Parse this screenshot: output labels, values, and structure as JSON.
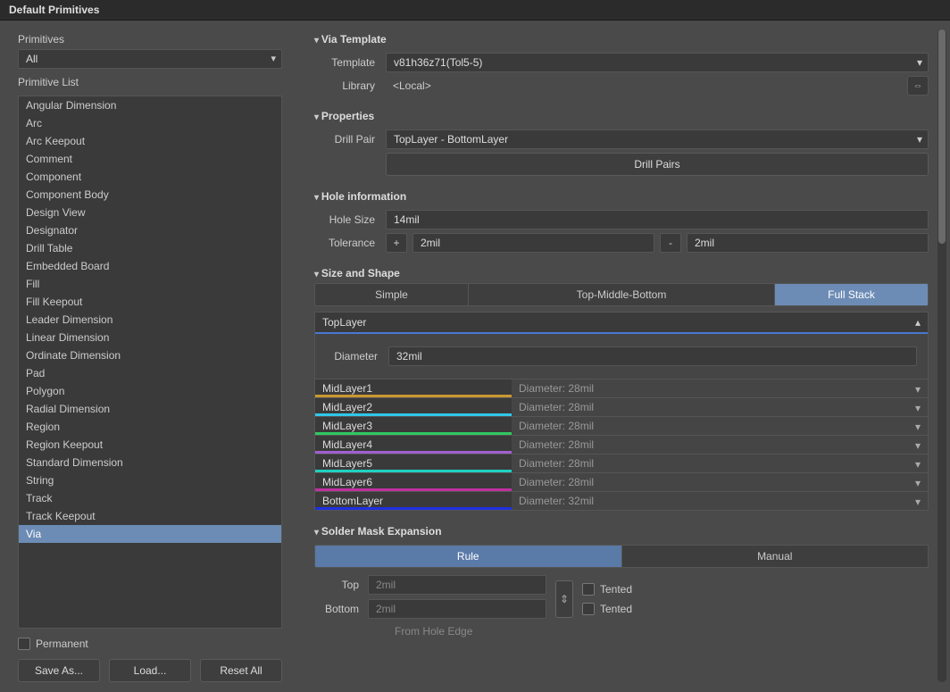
{
  "title": "Default Primitives",
  "left": {
    "primitives_label": "Primitives",
    "primitives_value": "All",
    "list_label": "Primitive List",
    "items": [
      "Angular Dimension",
      "Arc",
      "Arc Keepout",
      "Comment",
      "Component",
      "Component Body",
      "Design View",
      "Designator",
      "Drill Table",
      "Embedded Board",
      "Fill",
      "Fill Keepout",
      "Leader Dimension",
      "Linear Dimension",
      "Ordinate Dimension",
      "Pad",
      "Polygon",
      "Radial Dimension",
      "Region",
      "Region Keepout",
      "Standard Dimension",
      "String",
      "Track",
      "Track Keepout",
      "Via"
    ],
    "selected": "Via",
    "permanent": "Permanent",
    "save_as": "Save As...",
    "load": "Load...",
    "reset_all": "Reset All"
  },
  "via_template": {
    "header": "Via Template",
    "template_label": "Template",
    "template_value": "v81h36z71(Tol5-5)",
    "library_label": "Library",
    "library_value": "<Local>"
  },
  "properties": {
    "header": "Properties",
    "drill_pair_label": "Drill Pair",
    "drill_pair_value": "TopLayer - BottomLayer",
    "drill_pairs_btn": "Drill Pairs"
  },
  "hole": {
    "header": "Hole information",
    "size_label": "Hole Size",
    "size_value": "14mil",
    "tol_label": "Tolerance",
    "tol_plus": "2mil",
    "tol_minus": "2mil"
  },
  "size_shape": {
    "header": "Size and Shape",
    "tabs": {
      "simple": "Simple",
      "tmb": "Top-Middle-Bottom",
      "full": "Full Stack"
    },
    "top_layer": "TopLayer",
    "diameter_label": "Diameter",
    "diameter_value": "32mil",
    "layers": [
      {
        "name": "MidLayer1",
        "diam": "Diameter: 28mil",
        "stripe": "stripe-orange"
      },
      {
        "name": "MidLayer2",
        "diam": "Diameter: 28mil",
        "stripe": "stripe-cyan"
      },
      {
        "name": "MidLayer3",
        "diam": "Diameter: 28mil",
        "stripe": "stripe-green"
      },
      {
        "name": "MidLayer4",
        "diam": "Diameter: 28mil",
        "stripe": "stripe-purple"
      },
      {
        "name": "MidLayer5",
        "diam": "Diameter: 28mil",
        "stripe": "stripe-teal"
      },
      {
        "name": "MidLayer6",
        "diam": "Diameter: 28mil",
        "stripe": "stripe-magenta"
      },
      {
        "name": "BottomLayer",
        "diam": "Diameter: 32mil",
        "stripe": "stripe-blue"
      }
    ]
  },
  "solder_mask": {
    "header": "Solder Mask Expansion",
    "rule": "Rule",
    "manual": "Manual",
    "top_label": "Top",
    "top_value": "2mil",
    "bottom_label": "Bottom",
    "bottom_value": "2mil",
    "tented": "Tented",
    "from_edge": "From Hole Edge"
  }
}
